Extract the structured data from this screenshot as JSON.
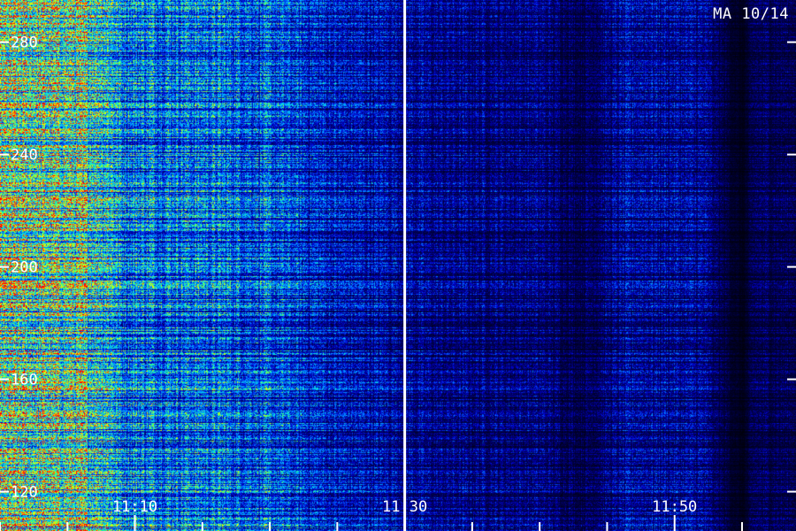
{
  "corner_label": "MA 10/14",
  "chart_data": {
    "type": "heatmap",
    "title": "",
    "xlabel": "",
    "ylabel": "",
    "x_tick_labels": [
      "11:10",
      "11:30",
      "11:50"
    ],
    "x_minor_ticks_per_major": 4,
    "x_range_minutes": [
      "11:00",
      "11:59"
    ],
    "y_ticks": [
      120,
      160,
      200,
      240,
      280
    ],
    "y_range": [
      106,
      295
    ],
    "event_marker_time": "11:30",
    "colormap": [
      "#000000",
      "#00004d",
      "#0000c8",
      "#0060ff",
      "#00c0ff",
      "#20ffa0",
      "#a0ff20",
      "#ffff00",
      "#ff8000",
      "#ff0000"
    ],
    "intensity_profile": [
      {
        "time": "11:00",
        "level": 0.62
      },
      {
        "time": "11:06",
        "level": 0.6
      },
      {
        "time": "11:08",
        "level": 0.52
      },
      {
        "time": "11:09",
        "level": 0.4
      },
      {
        "time": "11:15",
        "level": 0.38
      },
      {
        "time": "11:20",
        "level": 0.33
      },
      {
        "time": "11:25",
        "level": 0.24
      },
      {
        "time": "11:29",
        "level": 0.22
      },
      {
        "time": "11:32",
        "level": 0.18
      },
      {
        "time": "11:40",
        "level": 0.17
      },
      {
        "time": "11:43",
        "level": 0.12
      },
      {
        "time": "11:47",
        "level": 0.21
      },
      {
        "time": "11:52",
        "level": 0.19
      },
      {
        "time": "11:55",
        "level": 0.04
      },
      {
        "time": "11:56",
        "level": 0.13
      },
      {
        "time": "11:59",
        "level": 0.12
      }
    ]
  }
}
